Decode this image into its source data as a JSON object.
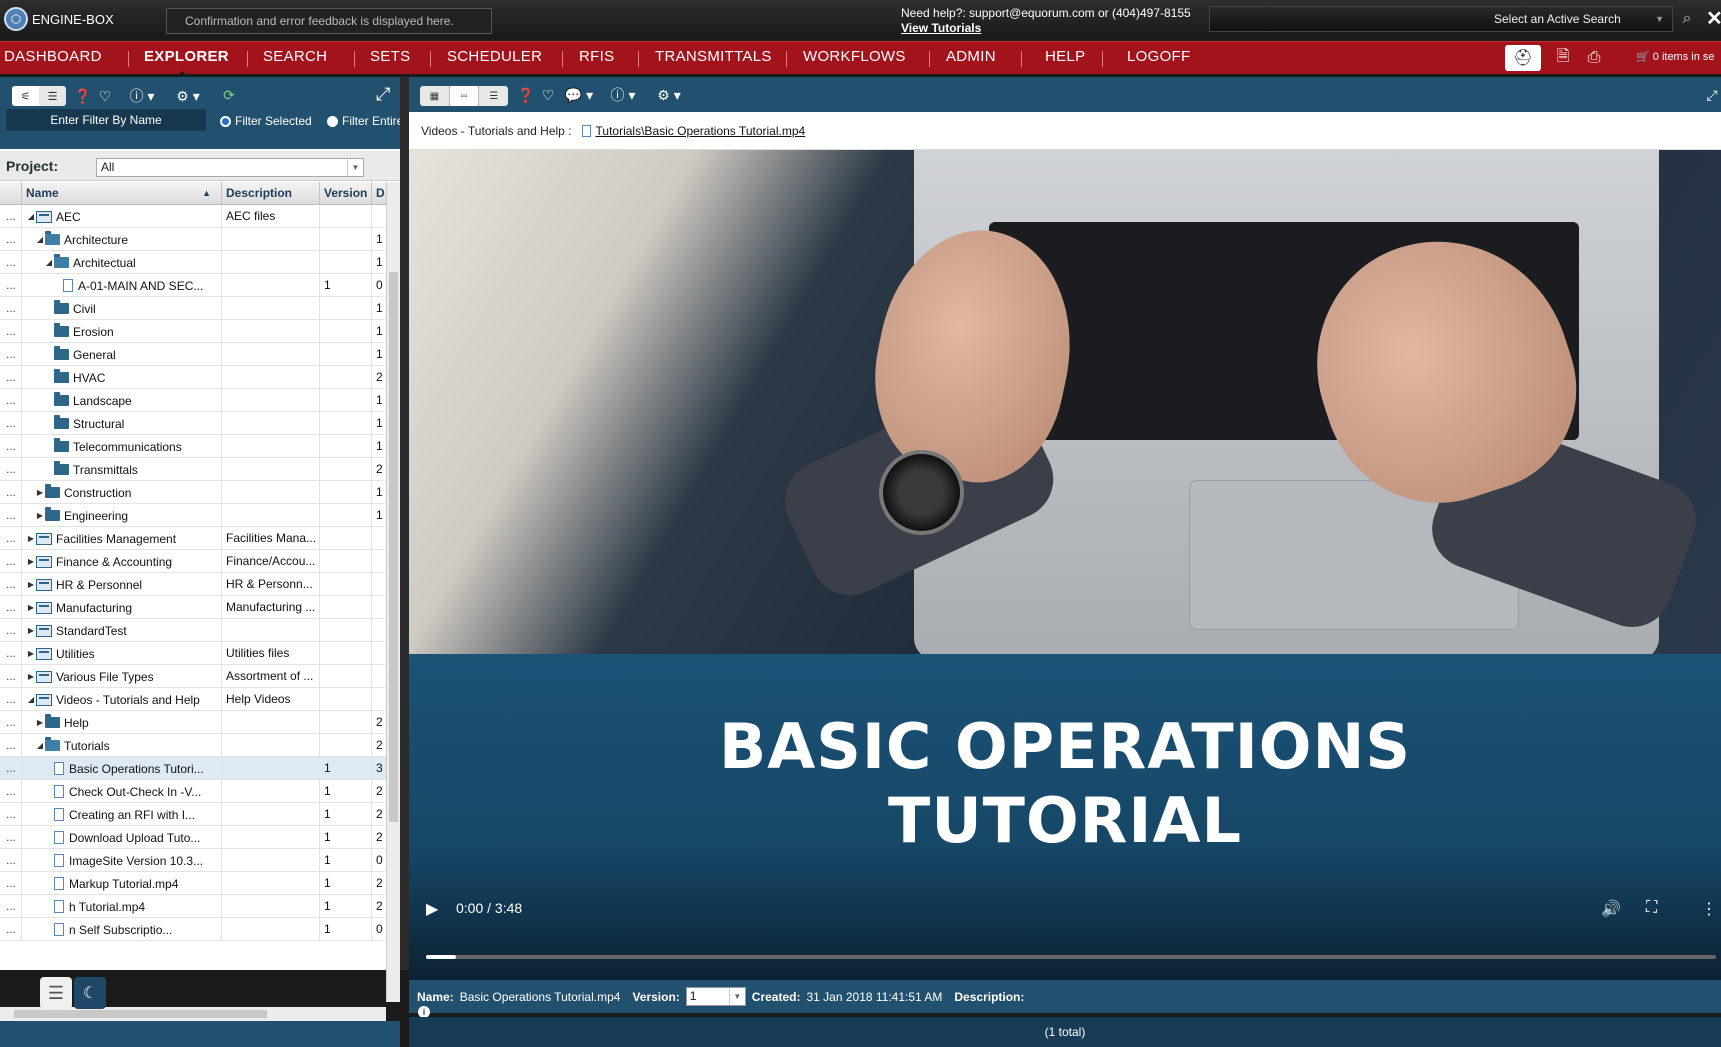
{
  "header": {
    "logo_text": "ENGINE-BOX",
    "feedback_text": "Confirmation and error feedback is displayed here.",
    "help_line": "Need help?: support@equorum.com or (404)497-8155",
    "help_link": "View Tutorials",
    "active_search_label": "Select an Active Search"
  },
  "nav": {
    "items": [
      "DASHBOARD",
      "EXPLORER",
      "SEARCH",
      "SETS",
      "SCHEDULER",
      "RFIS",
      "TRANSMITTALS",
      "WORKFLOWS",
      "ADMIN",
      "HELP",
      "LOGOFF"
    ],
    "active": "EXPLORER",
    "cart_text": "0 items in se"
  },
  "left_panel": {
    "filter_placeholder": "Enter Filter By Name",
    "radio_selected": "Filter Selected",
    "radio_entire": "Filter Entire",
    "project_label": "Project:",
    "project_value": "All",
    "columns": [
      "Name",
      "Description",
      "Version",
      "D"
    ],
    "rows": [
      {
        "name": "AEC",
        "desc": "AEC files",
        "ver": "",
        "d": "",
        "level": 0,
        "kind": "project",
        "tri": "open"
      },
      {
        "name": "Architecture",
        "desc": "",
        "ver": "",
        "d": "1",
        "level": 1,
        "kind": "folder",
        "tri": "open"
      },
      {
        "name": "Architectual",
        "desc": "",
        "ver": "",
        "d": "1",
        "level": 2,
        "kind": "folder",
        "tri": "open"
      },
      {
        "name": "A-01-MAIN AND SEC...",
        "desc": "",
        "ver": "1",
        "d": "0",
        "level": 3,
        "kind": "file",
        "tri": ""
      },
      {
        "name": "Civil",
        "desc": "",
        "ver": "",
        "d": "1",
        "level": 2,
        "kind": "folder",
        "tri": ""
      },
      {
        "name": "Erosion",
        "desc": "",
        "ver": "",
        "d": "1",
        "level": 2,
        "kind": "folder",
        "tri": ""
      },
      {
        "name": "General",
        "desc": "",
        "ver": "",
        "d": "1",
        "level": 2,
        "kind": "folder",
        "tri": ""
      },
      {
        "name": "HVAC",
        "desc": "",
        "ver": "",
        "d": "2",
        "level": 2,
        "kind": "folder",
        "tri": ""
      },
      {
        "name": "Landscape",
        "desc": "",
        "ver": "",
        "d": "1",
        "level": 2,
        "kind": "folder",
        "tri": ""
      },
      {
        "name": "Structural",
        "desc": "",
        "ver": "",
        "d": "1",
        "level": 2,
        "kind": "folder",
        "tri": ""
      },
      {
        "name": "Telecommunications",
        "desc": "",
        "ver": "",
        "d": "1",
        "level": 2,
        "kind": "folder",
        "tri": ""
      },
      {
        "name": "Transmittals",
        "desc": "",
        "ver": "",
        "d": "2",
        "level": 2,
        "kind": "folder",
        "tri": ""
      },
      {
        "name": "Construction",
        "desc": "",
        "ver": "",
        "d": "1",
        "level": 1,
        "kind": "folder",
        "tri": "closed"
      },
      {
        "name": "Engineering",
        "desc": "",
        "ver": "",
        "d": "1",
        "level": 1,
        "kind": "folder",
        "tri": "closed"
      },
      {
        "name": "Facilities Management",
        "desc": "Facilities Mana...",
        "ver": "",
        "d": "",
        "level": 0,
        "kind": "project",
        "tri": "closed"
      },
      {
        "name": "Finance & Accounting",
        "desc": "Finance/Accou...",
        "ver": "",
        "d": "",
        "level": 0,
        "kind": "project",
        "tri": "closed"
      },
      {
        "name": "HR & Personnel",
        "desc": "HR & Personn...",
        "ver": "",
        "d": "",
        "level": 0,
        "kind": "project",
        "tri": "closed"
      },
      {
        "name": "Manufacturing",
        "desc": "Manufacturing ...",
        "ver": "",
        "d": "",
        "level": 0,
        "kind": "project",
        "tri": "closed"
      },
      {
        "name": "StandardTest",
        "desc": "",
        "ver": "",
        "d": "",
        "level": 0,
        "kind": "project",
        "tri": "closed"
      },
      {
        "name": "Utilities",
        "desc": "Utilities files",
        "ver": "",
        "d": "",
        "level": 0,
        "kind": "project",
        "tri": "closed"
      },
      {
        "name": "Various File Types",
        "desc": "Assortment of ...",
        "ver": "",
        "d": "",
        "level": 0,
        "kind": "project",
        "tri": "closed"
      },
      {
        "name": "Videos - Tutorials and Help",
        "desc": "Help Videos",
        "ver": "",
        "d": "",
        "level": 0,
        "kind": "project",
        "tri": "open"
      },
      {
        "name": "Help",
        "desc": "",
        "ver": "",
        "d": "2",
        "level": 1,
        "kind": "folder",
        "tri": "closed"
      },
      {
        "name": "Tutorials",
        "desc": "",
        "ver": "",
        "d": "2",
        "level": 1,
        "kind": "folder",
        "tri": "open"
      },
      {
        "name": "Basic Operations Tutori...",
        "desc": "",
        "ver": "1",
        "d": "3",
        "level": 2,
        "kind": "file",
        "tri": "",
        "selected": true
      },
      {
        "name": "Check Out-Check In -V...",
        "desc": "",
        "ver": "1",
        "d": "2",
        "level": 2,
        "kind": "file",
        "tri": ""
      },
      {
        "name": "Creating an RFI with I...",
        "desc": "",
        "ver": "1",
        "d": "2",
        "level": 2,
        "kind": "file",
        "tri": ""
      },
      {
        "name": "Download Upload Tuto...",
        "desc": "",
        "ver": "1",
        "d": "2",
        "level": 2,
        "kind": "file",
        "tri": ""
      },
      {
        "name": "ImageSite Version 10.3...",
        "desc": "",
        "ver": "1",
        "d": "0",
        "level": 2,
        "kind": "file",
        "tri": ""
      },
      {
        "name": "Markup Tutorial.mp4",
        "desc": "",
        "ver": "1",
        "d": "2",
        "level": 2,
        "kind": "file",
        "tri": ""
      },
      {
        "name": "h Tutorial.mp4",
        "desc": "",
        "ver": "1",
        "d": "2",
        "level": 2,
        "kind": "file",
        "tri": ""
      },
      {
        "name": "n Self Subscriptio...",
        "desc": "",
        "ver": "1",
        "d": "0",
        "level": 2,
        "kind": "file",
        "tri": ""
      }
    ]
  },
  "right_panel": {
    "breadcrumb_project": "Videos - Tutorials and Help :",
    "breadcrumb_file": "Tutorials\\Basic Operations Tutorial.mp4",
    "video": {
      "title_line1": "BASIC OPERATIONS",
      "title_line2": "TUTORIAL",
      "time": "0:00 / 3:48",
      "progress_fraction": 0.0
    },
    "info": {
      "name_label": "Name:",
      "name_value": "Basic Operations Tutorial.mp4",
      "version_label": "Version:",
      "version_value": "1",
      "created_label": "Created:",
      "created_value": "31 Jan 2018 11:41:51 AM",
      "description_label": "Description:"
    },
    "total_text": "(1 total)"
  }
}
